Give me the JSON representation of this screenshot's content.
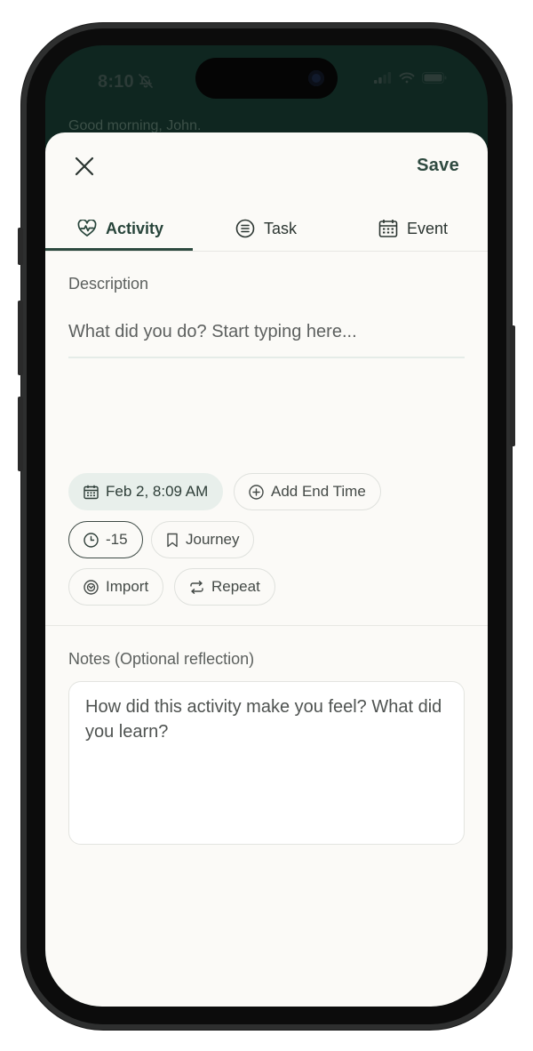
{
  "status_bar": {
    "time": "8:10"
  },
  "background": {
    "greeting": "Good morning, John."
  },
  "header": {
    "save_label": "Save"
  },
  "tabs": [
    {
      "label": "Activity",
      "icon": "heart-pulse-icon",
      "active": true
    },
    {
      "label": "Task",
      "icon": "list-icon",
      "active": false
    },
    {
      "label": "Event",
      "icon": "calendar-icon",
      "active": false
    }
  ],
  "description": {
    "label": "Description",
    "placeholder": "What did you do? Start typing here..."
  },
  "chips": {
    "date": "Feb 2, 8:09 AM",
    "end_time": "Add End Time",
    "offset": "-15",
    "journey": "Journey",
    "import": "Import",
    "repeat": "Repeat"
  },
  "notes": {
    "label": "Notes (Optional reflection)",
    "placeholder": "How did this activity make you feel? What did you learn?"
  },
  "colors": {
    "accent": "#2d4a40",
    "sheet_bg": "#fbfaf7",
    "chip_filled_bg": "#e8efeb",
    "screen_bg": "#0f2620"
  }
}
